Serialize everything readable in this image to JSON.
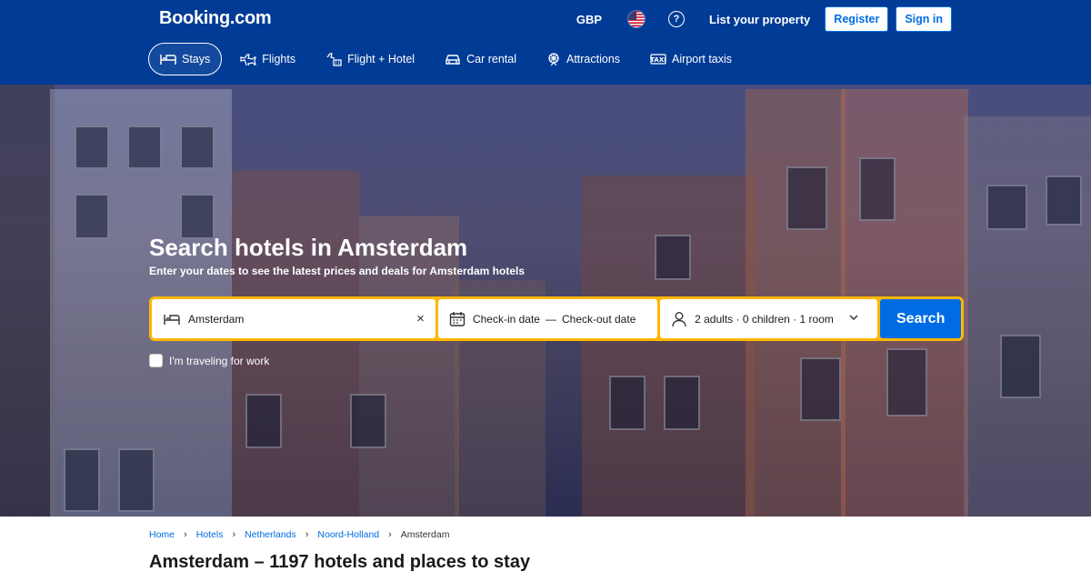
{
  "header": {
    "logo": "Booking.com",
    "currency": "GBP",
    "list_property": "List your property",
    "register": "Register",
    "sign_in": "Sign in",
    "help_icon": "?"
  },
  "nav": [
    {
      "label": "Stays",
      "icon": "bed-icon",
      "active": true
    },
    {
      "label": "Flights",
      "icon": "plane-icon"
    },
    {
      "label": "Flight + Hotel",
      "icon": "plane-hotel-icon"
    },
    {
      "label": "Car rental",
      "icon": "car-icon"
    },
    {
      "label": "Attractions",
      "icon": "attractions-icon"
    },
    {
      "label": "Airport taxis",
      "icon": "taxi-icon"
    }
  ],
  "hero": {
    "title": "Search hotels in Amsterdam",
    "subtitle": "Enter your dates to see the latest prices and deals for Amsterdam hotels"
  },
  "search": {
    "destination": "Amsterdam",
    "checkin": "Check-in date",
    "dash": "—",
    "checkout": "Check-out date",
    "occupancy": "2 adults · 0 children · 1 room",
    "button": "Search",
    "clear": "×"
  },
  "work": {
    "label": "I'm traveling for work"
  },
  "breadcrumb": {
    "items": [
      "Home",
      "Hotels",
      "Netherlands",
      "Noord-Holland"
    ],
    "current": "Amsterdam",
    "separator": "›"
  },
  "page_title": "Amsterdam – 1197 hotels and places to stay",
  "colors": {
    "brand": "#003b95",
    "accent": "#006ce4",
    "search_border": "#ffb700"
  }
}
